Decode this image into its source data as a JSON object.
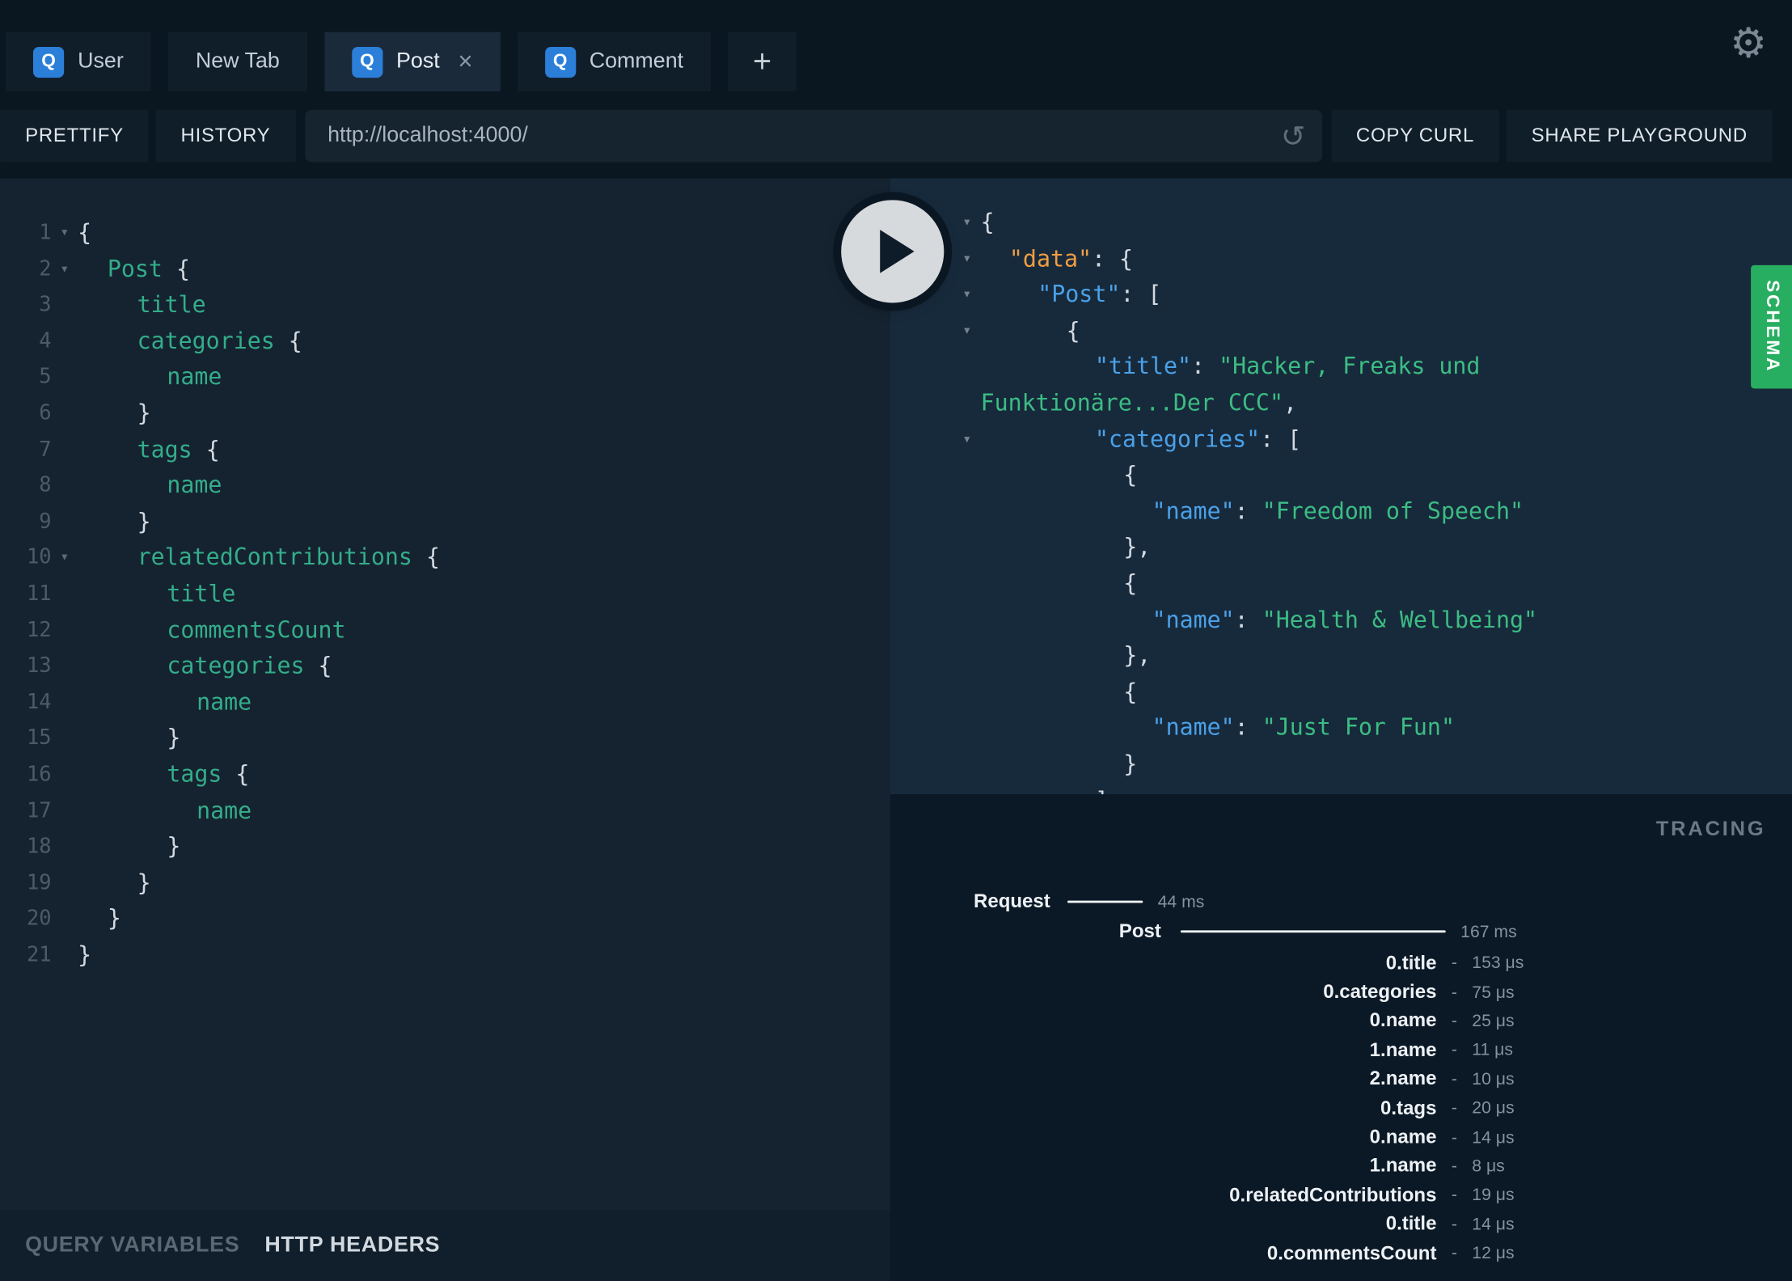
{
  "tab_bar": {
    "tabs": [
      {
        "label": "User",
        "badge": "Q",
        "active": false,
        "closable": false
      },
      {
        "label": "New Tab",
        "badge": null,
        "active": false,
        "closable": false
      },
      {
        "label": "Post",
        "badge": "Q",
        "active": true,
        "closable": true
      },
      {
        "label": "Comment",
        "badge": "Q",
        "active": false,
        "closable": false
      }
    ],
    "new_tab_button": "+",
    "close_label": "×",
    "settings_icon": "⚙"
  },
  "toolbar": {
    "prettify": "PRETTIFY",
    "history": "HISTORY",
    "url": "http://localhost:4000/",
    "reload_icon": "↺",
    "copy_curl": "COPY CURL",
    "share_playground": "SHARE PLAYGROUND"
  },
  "icons": {
    "fold_arrow": "▾",
    "collapse_arrow": "▾"
  },
  "query_editor": {
    "lines": [
      {
        "num": 1,
        "fold": true,
        "indent": 0,
        "tokens": [
          [
            "p",
            "{"
          ]
        ]
      },
      {
        "num": 2,
        "fold": true,
        "indent": 1,
        "tokens": [
          [
            "f",
            "Post"
          ],
          [
            "p",
            " {"
          ]
        ]
      },
      {
        "num": 3,
        "fold": false,
        "indent": 2,
        "tokens": [
          [
            "f",
            "title"
          ]
        ]
      },
      {
        "num": 4,
        "fold": false,
        "indent": 2,
        "tokens": [
          [
            "f",
            "categories"
          ],
          [
            "p",
            " {"
          ]
        ]
      },
      {
        "num": 5,
        "fold": false,
        "indent": 3,
        "tokens": [
          [
            "f",
            "name"
          ]
        ]
      },
      {
        "num": 6,
        "fold": false,
        "indent": 2,
        "tokens": [
          [
            "p",
            "}"
          ]
        ]
      },
      {
        "num": 7,
        "fold": false,
        "indent": 2,
        "tokens": [
          [
            "f",
            "tags"
          ],
          [
            "p",
            " {"
          ]
        ]
      },
      {
        "num": 8,
        "fold": false,
        "indent": 3,
        "tokens": [
          [
            "f",
            "name"
          ]
        ]
      },
      {
        "num": 9,
        "fold": false,
        "indent": 2,
        "tokens": [
          [
            "p",
            "}"
          ]
        ]
      },
      {
        "num": 10,
        "fold": true,
        "indent": 2,
        "tokens": [
          [
            "f",
            "relatedContributions"
          ],
          [
            "p",
            " {"
          ]
        ]
      },
      {
        "num": 11,
        "fold": false,
        "indent": 3,
        "tokens": [
          [
            "f",
            "title"
          ]
        ]
      },
      {
        "num": 12,
        "fold": false,
        "indent": 3,
        "tokens": [
          [
            "f",
            "commentsCount"
          ]
        ]
      },
      {
        "num": 13,
        "fold": false,
        "indent": 3,
        "tokens": [
          [
            "f",
            "categories"
          ],
          [
            "p",
            " {"
          ]
        ]
      },
      {
        "num": 14,
        "fold": false,
        "indent": 4,
        "tokens": [
          [
            "f",
            "name"
          ]
        ]
      },
      {
        "num": 15,
        "fold": false,
        "indent": 3,
        "tokens": [
          [
            "p",
            "}"
          ]
        ]
      },
      {
        "num": 16,
        "fold": false,
        "indent": 3,
        "tokens": [
          [
            "f",
            "tags"
          ],
          [
            "p",
            " {"
          ]
        ]
      },
      {
        "num": 17,
        "fold": false,
        "indent": 4,
        "tokens": [
          [
            "f",
            "name"
          ]
        ]
      },
      {
        "num": 18,
        "fold": false,
        "indent": 3,
        "tokens": [
          [
            "p",
            "}"
          ]
        ]
      },
      {
        "num": 19,
        "fold": false,
        "indent": 2,
        "tokens": [
          [
            "p",
            "}"
          ]
        ]
      },
      {
        "num": 20,
        "fold": false,
        "indent": 1,
        "tokens": [
          [
            "p",
            "}"
          ]
        ]
      },
      {
        "num": 21,
        "fold": false,
        "indent": 0,
        "tokens": [
          [
            "p",
            "}"
          ]
        ]
      }
    ]
  },
  "response_viewer": {
    "lines": [
      {
        "fold": true,
        "indent": 0,
        "tokens": [
          [
            "p",
            "{"
          ]
        ]
      },
      {
        "fold": true,
        "indent": 1,
        "tokens": [
          [
            "ko",
            "\"data\""
          ],
          [
            "p",
            ": {"
          ]
        ]
      },
      {
        "fold": true,
        "indent": 2,
        "tokens": [
          [
            "k",
            "\"Post\""
          ],
          [
            "p",
            ": ["
          ]
        ]
      },
      {
        "fold": true,
        "indent": 3,
        "tokens": [
          [
            "p",
            "{"
          ]
        ]
      },
      {
        "fold": false,
        "indent": 4,
        "tokens": [
          [
            "k",
            "\"title\""
          ],
          [
            "p",
            ": "
          ],
          [
            "s",
            "\"Hacker, Freaks und"
          ]
        ]
      },
      {
        "fold": false,
        "indent": 0,
        "tokens": [
          [
            "s",
            "Funktionäre...Der CCC\""
          ],
          [
            "p",
            ","
          ]
        ]
      },
      {
        "fold": true,
        "indent": 4,
        "tokens": [
          [
            "k",
            "\"categories\""
          ],
          [
            "p",
            ": ["
          ]
        ]
      },
      {
        "fold": false,
        "indent": 5,
        "tokens": [
          [
            "p",
            "{"
          ]
        ]
      },
      {
        "fold": false,
        "indent": 6,
        "tokens": [
          [
            "k",
            "\"name\""
          ],
          [
            "p",
            ": "
          ],
          [
            "s",
            "\"Freedom of Speech\""
          ]
        ]
      },
      {
        "fold": false,
        "indent": 5,
        "tokens": [
          [
            "p",
            "},"
          ]
        ]
      },
      {
        "fold": false,
        "indent": 5,
        "tokens": [
          [
            "p",
            "{"
          ]
        ]
      },
      {
        "fold": false,
        "indent": 6,
        "tokens": [
          [
            "k",
            "\"name\""
          ],
          [
            "p",
            ": "
          ],
          [
            "s",
            "\"Health & Wellbeing\""
          ]
        ]
      },
      {
        "fold": false,
        "indent": 5,
        "tokens": [
          [
            "p",
            "},"
          ]
        ]
      },
      {
        "fold": false,
        "indent": 5,
        "tokens": [
          [
            "p",
            "{"
          ]
        ]
      },
      {
        "fold": false,
        "indent": 6,
        "tokens": [
          [
            "k",
            "\"name\""
          ],
          [
            "p",
            ": "
          ],
          [
            "s",
            "\"Just For Fun\""
          ]
        ]
      },
      {
        "fold": false,
        "indent": 5,
        "tokens": [
          [
            "p",
            "}"
          ]
        ]
      },
      {
        "fold": false,
        "indent": 4,
        "tokens": [
          [
            "p",
            "]"
          ]
        ]
      }
    ]
  },
  "schema_tab": {
    "label": "SCHEMA"
  },
  "tracing": {
    "title": "TRACING",
    "request": {
      "label": "Request",
      "time": "44 ms"
    },
    "operation": {
      "label": "Post",
      "time": "167 ms"
    },
    "resolvers": [
      {
        "label": "0.title",
        "time": "153 μs"
      },
      {
        "label": "0.categories",
        "time": "75 μs"
      },
      {
        "label": "0.name",
        "time": "25 μs"
      },
      {
        "label": "1.name",
        "time": "11 μs"
      },
      {
        "label": "2.name",
        "time": "10 μs"
      },
      {
        "label": "0.tags",
        "time": "20 μs"
      },
      {
        "label": "0.name",
        "time": "14 μs"
      },
      {
        "label": "1.name",
        "time": "8 μs"
      },
      {
        "label": "0.relatedContributions",
        "time": "19 μs"
      },
      {
        "label": "0.title",
        "time": "14 μs"
      },
      {
        "label": "0.commentsCount",
        "time": "12 μs"
      }
    ]
  },
  "bottom_bar": {
    "query_variables": "QUERY VARIABLES",
    "http_headers": "HTTP HEADERS"
  }
}
